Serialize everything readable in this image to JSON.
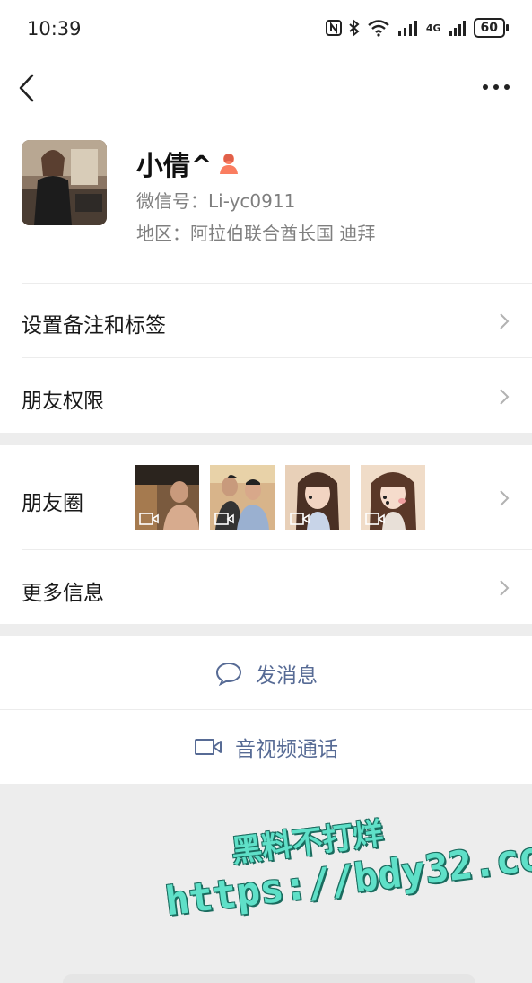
{
  "status_bar": {
    "time": "10:39",
    "signal_label": "4G",
    "battery": "60"
  },
  "nav": {
    "back_icon": "chevron-left-icon",
    "more_icon": "more-horizontal-icon"
  },
  "profile": {
    "name": "小倩^",
    "wechat_id": "微信号：Li-yc0911",
    "region": "地区：阿拉伯联合酋长国  迪拜",
    "gender_icon": "female-user-icon",
    "gender_color": "#fa7d60"
  },
  "menu": {
    "remark_tags": "设置备注和标签",
    "friend_permissions": "朋友权限",
    "moments": "朋友圈",
    "more_info": "更多信息"
  },
  "actions": {
    "send_message": "发消息",
    "video_call": "音视频通话"
  },
  "watermark": {
    "line1": "黑料不打烊",
    "line2": "https://bdy32.co"
  },
  "colors": {
    "link_blue": "#576b95",
    "background": "#ededed"
  }
}
